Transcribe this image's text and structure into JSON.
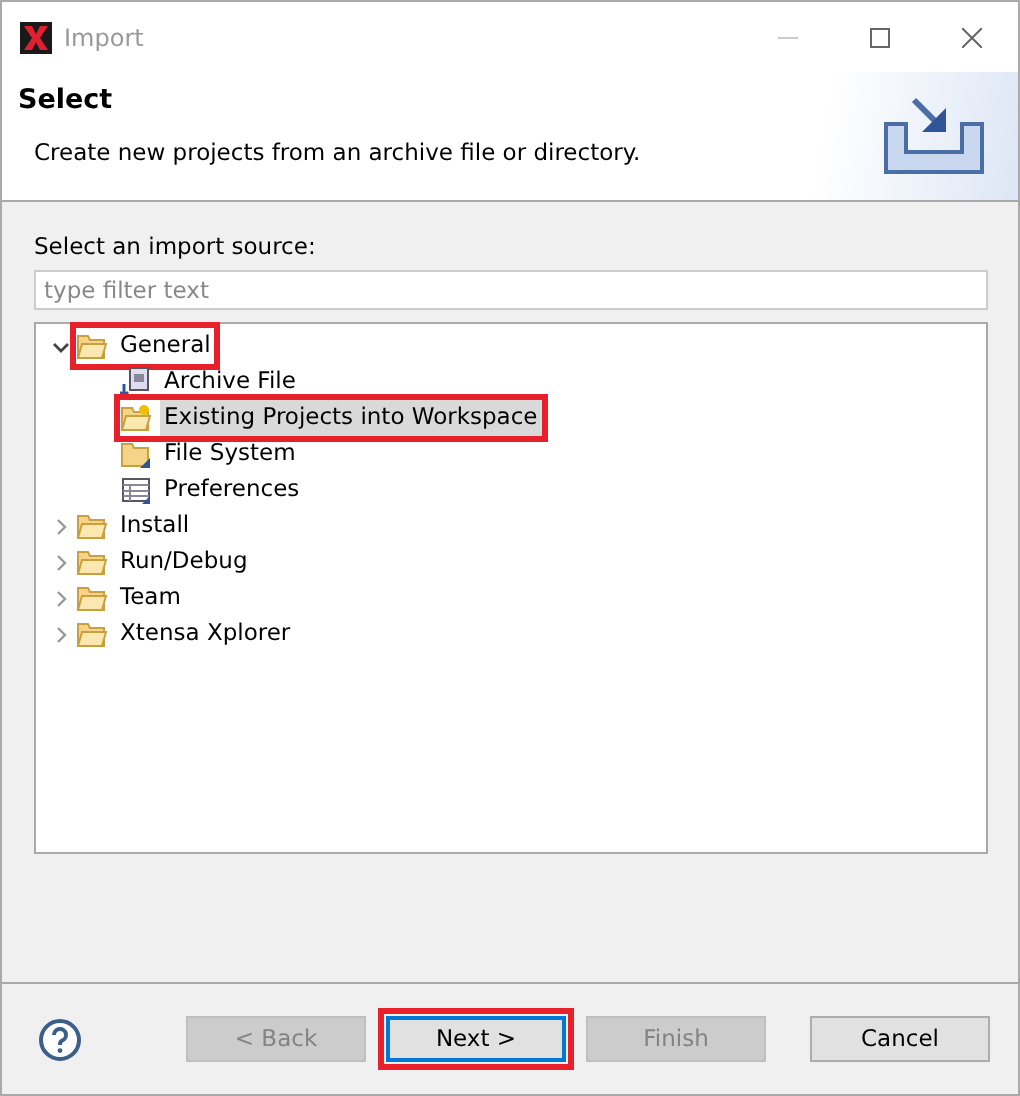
{
  "window": {
    "title": "Import"
  },
  "header": {
    "title": "Select",
    "description": "Create new projects from an archive file or directory."
  },
  "source_label": "Select an import source:",
  "filter": {
    "placeholder": "type filter text"
  },
  "tree": [
    {
      "label": "General",
      "kind": "folder",
      "expanded": true,
      "selected": false,
      "highlighted": true,
      "children": [
        {
          "label": "Archive File",
          "kind": "archive",
          "selected": false,
          "highlighted": false
        },
        {
          "label": "Existing Projects into Workspace",
          "kind": "project",
          "selected": true,
          "highlighted": true
        },
        {
          "label": "File System",
          "kind": "filesystem",
          "selected": false,
          "highlighted": false
        },
        {
          "label": "Preferences",
          "kind": "preferences",
          "selected": false,
          "highlighted": false
        }
      ]
    },
    {
      "label": "Install",
      "kind": "folder",
      "expanded": false,
      "selected": false,
      "highlighted": false
    },
    {
      "label": "Run/Debug",
      "kind": "folder",
      "expanded": false,
      "selected": false,
      "highlighted": false
    },
    {
      "label": "Team",
      "kind": "folder",
      "expanded": false,
      "selected": false,
      "highlighted": false
    },
    {
      "label": "Xtensa Xplorer",
      "kind": "folder",
      "expanded": false,
      "selected": false,
      "highlighted": false
    }
  ],
  "buttons": [
    {
      "label": "< Back",
      "disabled": true,
      "focused": false,
      "highlighted": false
    },
    {
      "label": "Next >",
      "disabled": false,
      "focused": true,
      "highlighted": true
    },
    {
      "label": "Finish",
      "disabled": true,
      "focused": false,
      "highlighted": false
    },
    {
      "label": "Cancel",
      "disabled": false,
      "focused": false,
      "highlighted": false
    }
  ]
}
